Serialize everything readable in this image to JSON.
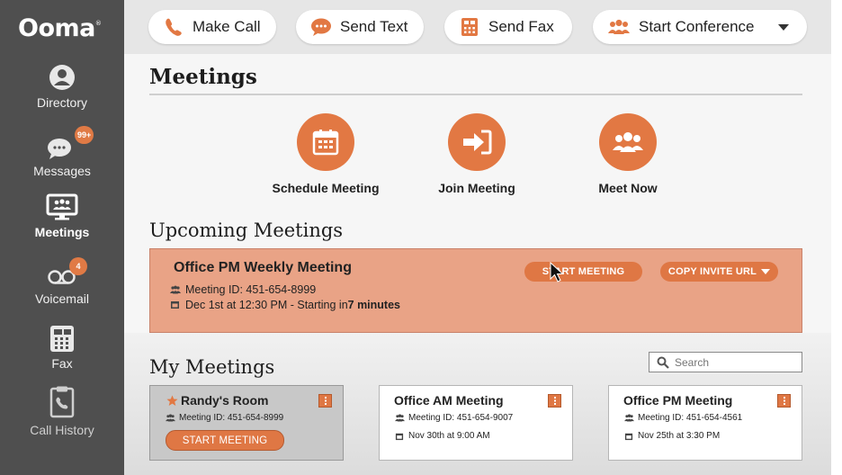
{
  "brand": {
    "logo_text": "Ooma"
  },
  "sidebar": {
    "items": [
      {
        "label": "Directory",
        "icon": "person-icon"
      },
      {
        "label": "Messages",
        "icon": "chat-bubble-icon",
        "badge": "99+"
      },
      {
        "label": "Meetings",
        "icon": "meetings-monitor-icon",
        "active": true
      },
      {
        "label": "Voicemail",
        "icon": "voicemail-icon",
        "badge": "4"
      },
      {
        "label": "Fax",
        "icon": "fax-icon"
      },
      {
        "label": "Call History",
        "icon": "call-history-clipboard-icon"
      }
    ]
  },
  "toolbar": {
    "make_call": "Make Call",
    "send_text": "Send Text",
    "send_fax": "Send Fax",
    "start_conference": "Start Conference"
  },
  "meetings": {
    "title": "Meetings",
    "actions": [
      {
        "label": "Schedule Meeting",
        "icon": "calendar-icon"
      },
      {
        "label": "Join Meeting",
        "icon": "sign-in-arrow-icon"
      },
      {
        "label": "Meet Now",
        "icon": "group-icon"
      }
    ]
  },
  "upcoming": {
    "heading": "Upcoming Meetings",
    "title": "Office PM Weekly Meeting",
    "meeting_id": "Meeting ID: 451-654-8999",
    "when_prefix": "Dec 1st at 12:30 PM - Starting in ",
    "when_emphasis": "7 minutes",
    "start_button": "START MEETING",
    "copy_button": "COPY INVITE URL"
  },
  "my_meetings": {
    "heading": "My Meetings",
    "search_placeholder": "Search",
    "cards": [
      {
        "title": "Randy's Room",
        "starred": true,
        "meeting_id": "Meeting ID: 451-654-8999",
        "button": "START MEETING"
      },
      {
        "title": "Office AM Meeting",
        "meeting_id": "Meeting ID: 451-654-9007",
        "date": "Nov 30th at 9:00 AM"
      },
      {
        "title": "Office PM Meeting",
        "meeting_id": "Meeting ID: 451-654-4561",
        "date": "Nov 25th at 3:30 PM"
      }
    ]
  },
  "colors": {
    "accent": "#e27843",
    "sidebar": "#4f4f4f",
    "upcoming_bg": "#e9a386"
  }
}
